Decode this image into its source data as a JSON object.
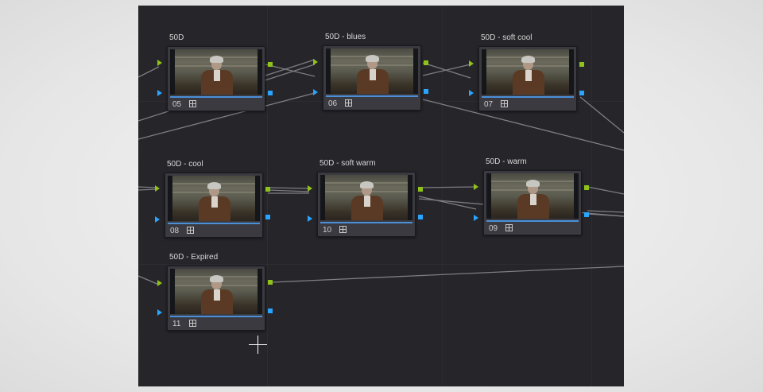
{
  "nodes": [
    {
      "label": "50D",
      "number": "05"
    },
    {
      "label": "50D - blues",
      "number": "06"
    },
    {
      "label": "50D - soft cool",
      "number": "07"
    },
    {
      "label": "50D - cool",
      "number": "08"
    },
    {
      "label": "50D - soft warm",
      "number": "10"
    },
    {
      "label": "50D - warm",
      "number": "09"
    },
    {
      "label": "50D - Expired",
      "number": "11"
    }
  ],
  "colors": {
    "canvas": "#25252a",
    "node": "#3a3a40",
    "rgb_port": "#8fc21a",
    "alpha_port": "#2aa5ff",
    "wire": "#8d8d92",
    "selection_bar": "#4a8fd8"
  },
  "icons": {
    "node_grid": "grid-icon",
    "cursor": "crosshair-cursor-icon"
  }
}
